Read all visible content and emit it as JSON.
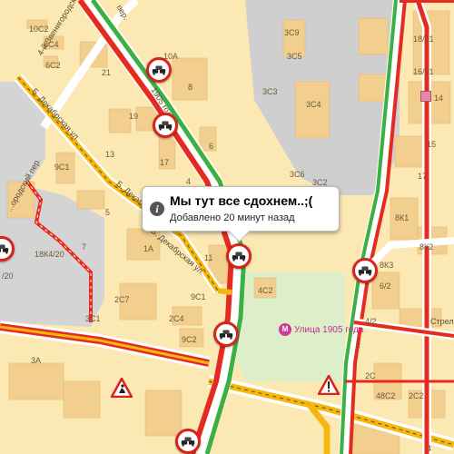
{
  "popup": {
    "title": "Мы тут все сдохнем..;(",
    "subtitle": "Добавлено 20 минут назад"
  },
  "poi": {
    "metro_letter": "М",
    "name": "Улица 1905 года"
  },
  "streets": {
    "zvenigorod_lane": "4-й Звенигородский пер.",
    "b_dekabrskaya_1": "Б. Декабрская ул.",
    "b_dekabrskaya_2": "Б. Декабрская ул.",
    "b_dekabrskaya_3": "Б. Декабрская ул.",
    "zvenigorod_left": "...ородский пер.",
    "goda_street": "1905 года",
    "pereulok": "пер.",
    "right_edge": "Стрел"
  },
  "building_labels": {
    "b_10c2": "10С2",
    "b_8c4": "8С4",
    "b_6c2": "6С2",
    "b_21": "21",
    "b_19": "19",
    "b_10a": "10А",
    "b_8": "8",
    "b_6": "6",
    "b_4": "4",
    "b_17": "17",
    "b_13": "13",
    "b_9c1": "9С1",
    "b_5": "5",
    "b_1a": "1А",
    "b_7": "7",
    "b_18k4": "18К4/20",
    "b_20": "/20",
    "b_3c1": "3С1",
    "b_2c7": "2С7",
    "b_2c4": "2С4",
    "b_9c1b": "9С1",
    "b_9c2": "9С2",
    "b_11": "11",
    "b_4c2": "4С2",
    "b_3a": "3А",
    "b_3c9": "3С9",
    "b_3c5": "3С5",
    "b_3c3": "3С3",
    "b_3c4": "3С4",
    "b_3c6": "3С6",
    "b_3c2": "3С2",
    "b_18_21": "18/21",
    "b_16_21": "16/21",
    "b_14": "14",
    "b_8k1": "8К1",
    "b_8k3": "8К3",
    "b_6_2": "6/2",
    "b_4_2": "4/2",
    "b_48c2": "48С2",
    "b_2c2": "2С2",
    "b_2": "2",
    "b_17b": "17",
    "b_8k2": "8К2",
    "b_15": "15",
    "b_2c": "2С",
    "b_4b": "4"
  },
  "icons": {
    "incident": "traffic-jam-incident-icon",
    "roadworks": "roadworks-warning-icon",
    "hazard": "hazard-warning-icon"
  },
  "colors": {
    "jam": "#e52b1f",
    "heavy": "#f5b70f",
    "free": "#3cb043",
    "map_bg": "#fbe8b3",
    "building": "#f2cf8e",
    "industrial": "#cfcfcf",
    "park": "#dcefc9"
  }
}
